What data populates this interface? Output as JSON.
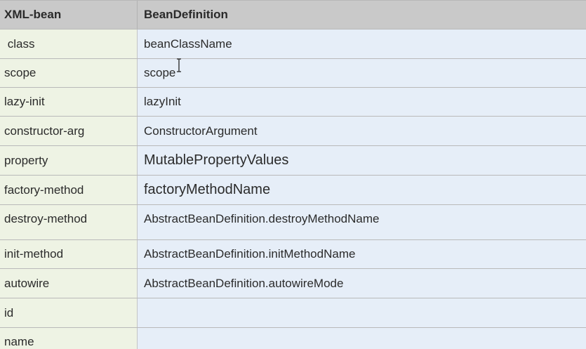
{
  "header": {
    "col1": "XML-bean",
    "col2": "BeanDefinition"
  },
  "rows": [
    {
      "xml": " class",
      "bean": "beanClassName"
    },
    {
      "xml": "scope",
      "bean": "scope"
    },
    {
      "xml": "lazy-init",
      "bean": "lazyInit"
    },
    {
      "xml": "constructor-arg",
      "bean": "ConstructorArgument"
    },
    {
      "xml": "property",
      "bean": "MutablePropertyValues"
    },
    {
      "xml": "factory-method",
      "bean": "factoryMethodName"
    },
    {
      "xml": "destroy-method",
      "bean": "AbstractBeanDefinition.destroyMethodName"
    },
    {
      "xml": "init-method",
      "bean": "AbstractBeanDefinition.initMethodName"
    },
    {
      "xml": "autowire",
      "bean": "AbstractBeanDefinition.autowireMode"
    },
    {
      "xml": "id",
      "bean": ""
    },
    {
      "xml": "name",
      "bean": ""
    }
  ],
  "icons": {
    "cursor": "text-cursor-icon"
  }
}
